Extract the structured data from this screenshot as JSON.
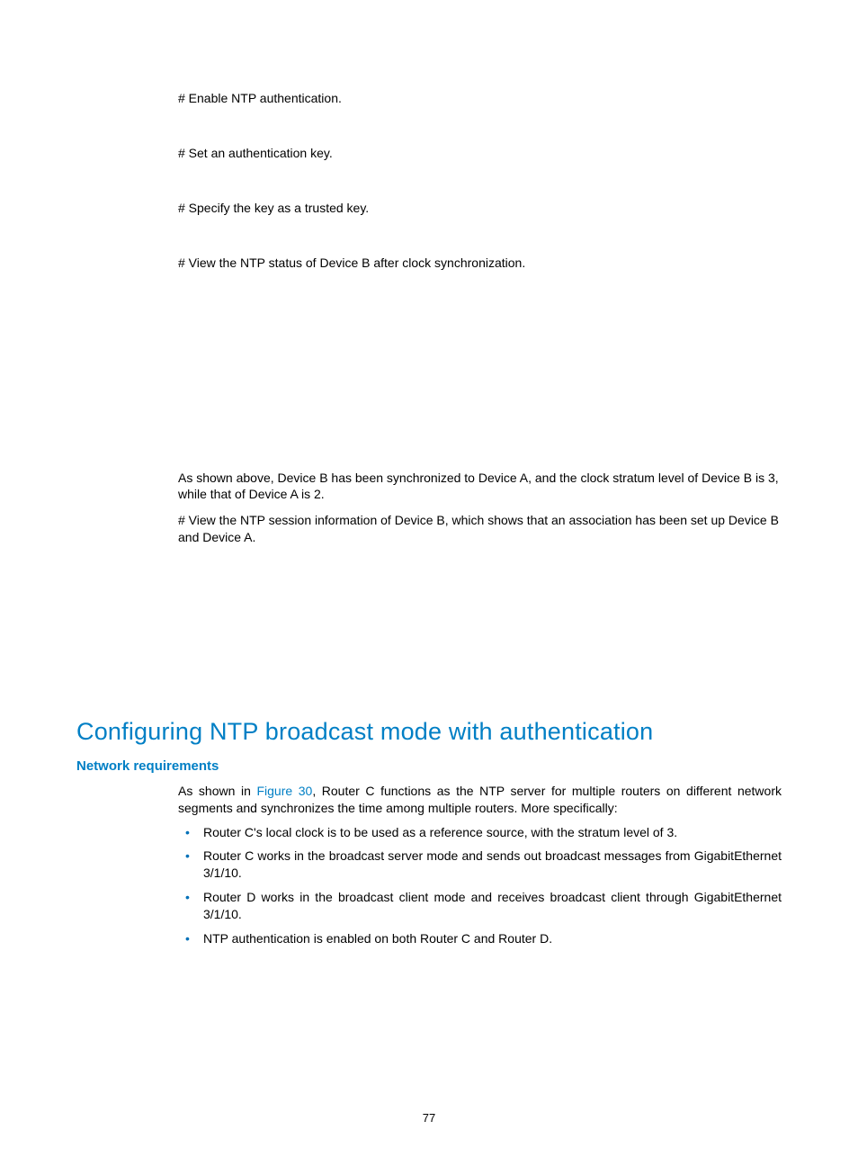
{
  "steps": {
    "s1": "# Enable NTP authentication.",
    "s2": "# Set an authentication key.",
    "s3": "# Specify the key as a trusted key.",
    "s4": "# View the NTP status of Device B after clock synchronization."
  },
  "sync_para": "As shown above, Device B has been synchronized to Device A, and the clock stratum level of Device B is 3, while that of Device A is 2.",
  "session_para": "# View the NTP session information of Device B, which shows that an association has been set up Device B and Device A.",
  "section": {
    "title": "Configuring NTP broadcast mode with authentication",
    "subheading": "Network requirements",
    "intro_pre": "As shown in ",
    "intro_link": "Figure 30",
    "intro_post": ", Router C functions as the NTP server for multiple routers on different network segments and synchronizes the time among multiple routers. More specifically:",
    "bullets": {
      "b1": "Router C's local clock is to be used as a reference source, with the stratum level of 3.",
      "b2": "Router C works in the broadcast server mode and sends out broadcast messages from GigabitEthernet 3/1/10.",
      "b3": "Router D works in the broadcast client mode and receives broadcast client through GigabitEthernet 3/1/10.",
      "b4": "NTP authentication is enabled on both Router C and Router D."
    }
  },
  "page_number": "77"
}
